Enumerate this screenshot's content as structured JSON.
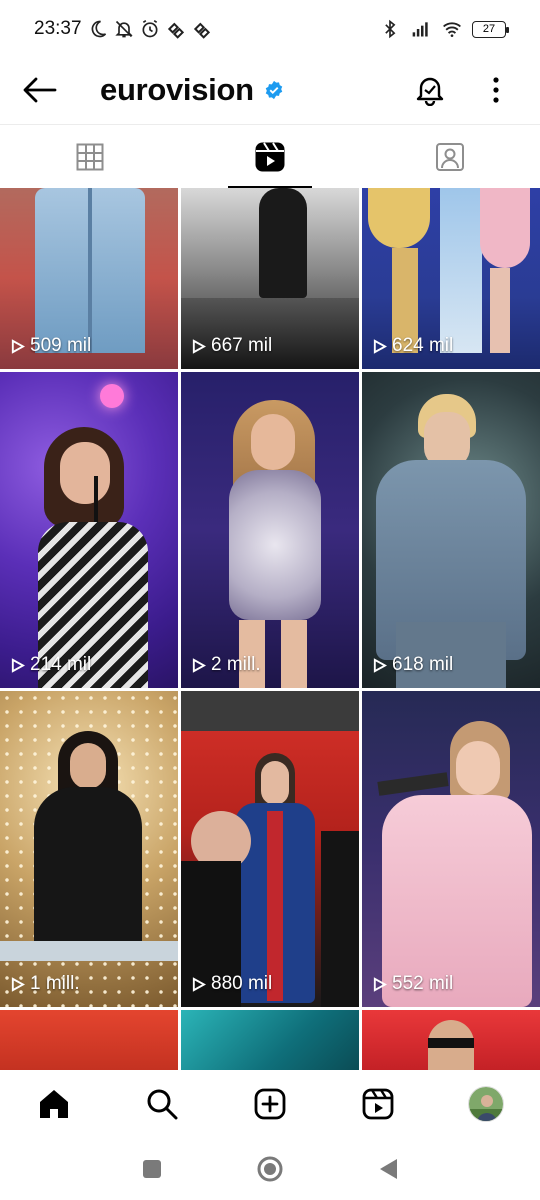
{
  "status_bar": {
    "time": "23:37",
    "battery": "27",
    "icons_left": [
      "moon-icon",
      "bell-off-icon",
      "alarm-icon",
      "heart-link-icon",
      "heart-link-icon"
    ],
    "icons_right": [
      "bluetooth-icon",
      "signal-icon",
      "wifi-icon",
      "battery-icon"
    ]
  },
  "header": {
    "title": "eurovision",
    "verified_color": "#1d9bf0"
  },
  "tabs": [
    {
      "name": "grid-tab",
      "icon": "grid-icon",
      "active": false
    },
    {
      "name": "reels-tab",
      "icon": "reels-icon",
      "active": true
    },
    {
      "name": "tagged-tab",
      "icon": "tagged-icon",
      "active": false
    }
  ],
  "reels": [
    {
      "views": "509 mil"
    },
    {
      "views": "667 mil"
    },
    {
      "views": "624 mil"
    },
    {
      "views": "214 mil"
    },
    {
      "views": "2 mill."
    },
    {
      "views": "618 mil"
    },
    {
      "views": "1 mill."
    },
    {
      "views": "880 mil"
    },
    {
      "views": "552 mil"
    }
  ],
  "bottom_nav": [
    "home-icon",
    "search-icon",
    "create-icon",
    "reels-icon",
    "profile-avatar"
  ],
  "system_nav": [
    "recents-button",
    "home-button",
    "back-button"
  ]
}
